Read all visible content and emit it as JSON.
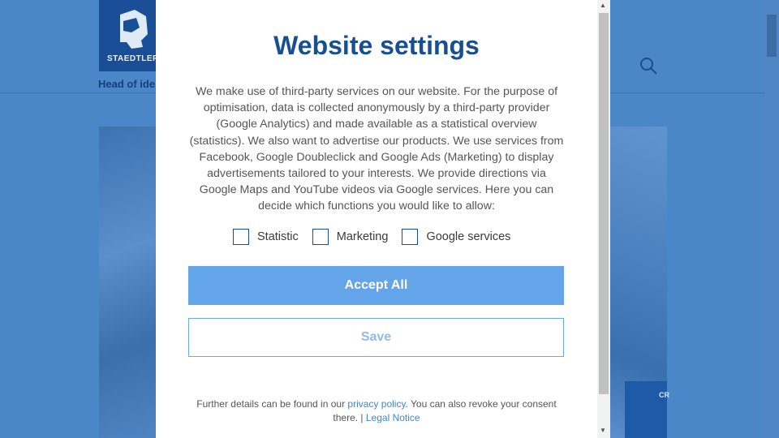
{
  "background": {
    "logo_text": "STAEDTLER",
    "tagline": "Head of ide",
    "pack_text": "CR"
  },
  "modal": {
    "title": "Website settings",
    "body": "We make use of third-party services on our website. For the purpose of optimisation, data is collected anonymously by a third-party provider (Google Analytics) and made available as a statistical overview (statistics). We also want to advertise our products. We use services from Facebook, Google Doubleclick and Google Ads (Marketing) to display advertisements tailored to your interests. We provide directions via Google Maps and YouTube videos via Google services. Here you can decide which functions you would like to allow:",
    "options": [
      {
        "label": "Statistic",
        "checked": false
      },
      {
        "label": "Marketing",
        "checked": false
      },
      {
        "label": "Google services",
        "checked": false
      }
    ],
    "accept_label": "Accept All",
    "save_label": "Save",
    "footer_prefix": "Further details can be found in our ",
    "privacy_link": "privacy policy",
    "footer_middle": ". You can also revoke your consent there. | ",
    "legal_link": "Legal Notice"
  },
  "colors": {
    "overlay_blue": "#4a86c8",
    "title_blue": "#174f91",
    "accept_button": "#64a4e8"
  },
  "icons": [
    "staedtler-logo-icon",
    "search-icon",
    "scroll-up-icon",
    "scroll-down-icon"
  ]
}
